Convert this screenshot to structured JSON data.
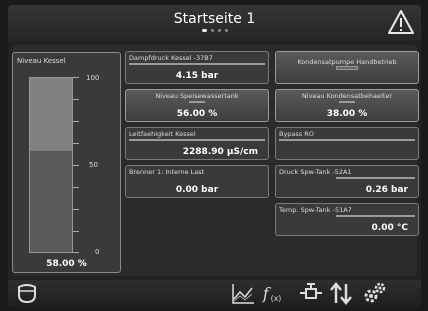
{
  "header": {
    "title": "Startseite 1",
    "pages": 4,
    "active_page": 0
  },
  "level": {
    "label": "Niveau Kessel",
    "scale_max": "100",
    "scale_mid": "50",
    "scale_min": "0",
    "fill_fraction": 0.58,
    "value": "58.00 %"
  },
  "tiles": {
    "dampfdruck": {
      "label": "Dampfdruck Kessel -37B7",
      "value": "4.15 bar"
    },
    "kondensatpumpe": {
      "label": "Kondensatpumpe Handbetrieb"
    },
    "speisewasser": {
      "label": "Niveau Speisewassertank",
      "value": "56.00 %"
    },
    "kondensatbehaelter": {
      "label": "Niveau Kondensatbehaelter",
      "value": "38.00 %"
    },
    "leitfaehigkeit": {
      "label": "Leitfaehigkeit Kessel",
      "value": "2288.90 µS/cm"
    },
    "bypass": {
      "label": "Bypass RO"
    },
    "brenner": {
      "label": "Brenner 1: Interne Last",
      "value": "0.00 bar"
    },
    "druck_spw": {
      "label": "Druck Spw-Tank -52A1",
      "value": "0.26 bar"
    },
    "temp_spw": {
      "label": "Temp. Spw-Tank -51A7",
      "value": "0.00 °C"
    }
  },
  "toolbar": {
    "icons": [
      "boiler-icon",
      "trend-chart-icon",
      "function-icon",
      "valve-icon",
      "transfer-arrows-icon",
      "settings-gears-icon"
    ],
    "function_label": "f(x)"
  }
}
